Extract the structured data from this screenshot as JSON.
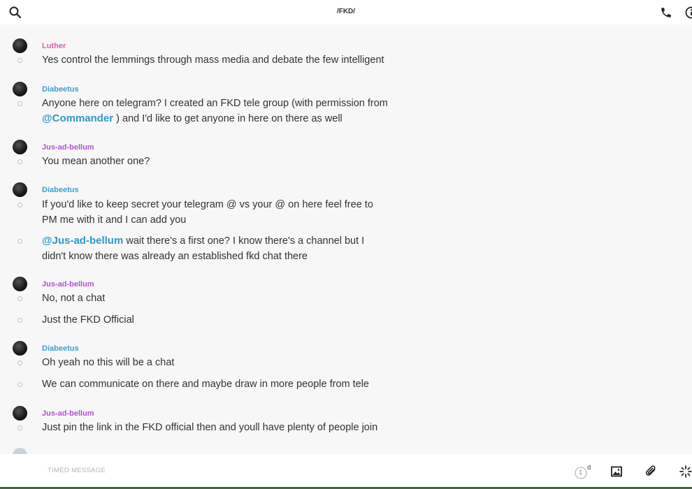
{
  "header": {
    "title": "/FKD/"
  },
  "messages": [
    {
      "author": "Luther",
      "author_color": "#e05fb0",
      "lines": [
        {
          "parts": [
            {
              "text": "Yes control the lemmings through mass media and debate the few intelligent"
            }
          ]
        }
      ]
    },
    {
      "author": "Diabeetus",
      "author_color": "#3f9fcf",
      "lines": [
        {
          "parts": [
            {
              "text": "Anyone here on telegram? I created an FKD tele group (with permission from "
            },
            {
              "text": "@Commander",
              "mention": true
            },
            {
              "text": " ) and I'd like to get anyone in here on there as well"
            }
          ]
        }
      ]
    },
    {
      "author": "Jus-ad-bellum",
      "author_color": "#b154cf",
      "lines": [
        {
          "parts": [
            {
              "text": "You mean another one?"
            }
          ]
        }
      ]
    },
    {
      "author": "Diabeetus",
      "author_color": "#3f9fcf",
      "lines": [
        {
          "parts": [
            {
              "text": "If you'd like to keep secret your telegram @ vs your @ on here feel free to PM me with it and I can add you"
            }
          ]
        },
        {
          "parts": [
            {
              "text": "@Jus-ad-bellum",
              "mention": true
            },
            {
              "text": " wait there's a first one? I know there's a channel but I didn't know there was already an established fkd chat there"
            }
          ]
        }
      ]
    },
    {
      "author": "Jus-ad-bellum",
      "author_color": "#b154cf",
      "lines": [
        {
          "parts": [
            {
              "text": "No, not a chat"
            }
          ]
        },
        {
          "parts": [
            {
              "text": "Just the FKD Official"
            }
          ]
        }
      ]
    },
    {
      "author": "Diabeetus",
      "author_color": "#3f9fcf",
      "lines": [
        {
          "parts": [
            {
              "text": "Oh yeah no this will be a chat"
            }
          ]
        },
        {
          "parts": [
            {
              "text": "We can communicate on there and maybe draw in more people from tele"
            }
          ]
        }
      ]
    },
    {
      "author": "Jus-ad-bellum",
      "author_color": "#b154cf",
      "lines": [
        {
          "parts": [
            {
              "text": "Just pin the link in the FKD official then and youll have plenty of people join"
            }
          ]
        }
      ]
    }
  ],
  "composer": {
    "placeholder": "TIMED MESSAGE",
    "timer_value": "1",
    "timer_unit": "d"
  },
  "icons": {
    "search": "search-icon",
    "phone": "phone-icon",
    "info": "info-icon",
    "timer": "timer-icon",
    "image": "image-icon",
    "attach": "paperclip-icon",
    "effects": "sparkle-icon"
  }
}
